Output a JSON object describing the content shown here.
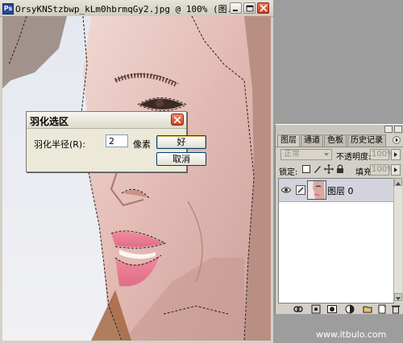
{
  "document_window": {
    "title": "OrsyKNStzbwp_kLm0hbrmqGy2.jpg @ 100% (图...",
    "app_icon_glyph": "Ps",
    "minimize_icon": "minimize-icon",
    "maximize_icon": "maximize-icon",
    "close_icon": "close-icon"
  },
  "feather_dialog": {
    "title": "羽化选区",
    "radius_label": "羽化半径(R):",
    "radius_value": "2",
    "unit_label": "像素",
    "ok_label": "好",
    "cancel_label": "取消"
  },
  "layers_panel": {
    "tabs": [
      {
        "label": "图层",
        "active": true
      },
      {
        "label": "通道",
        "active": false
      },
      {
        "label": "色板",
        "active": false
      },
      {
        "label": "历史记录",
        "active": false
      }
    ],
    "blend_mode": "正常",
    "opacity_label": "不透明度:",
    "opacity_value": "100%",
    "lock_label": "锁定:",
    "fill_label": "填充:",
    "fill_value": "100%",
    "layers": [
      {
        "name": "图层 0",
        "visible": true
      }
    ]
  },
  "watermark": "www.itbulo.com",
  "colors": {
    "background": "#9d9d9d",
    "panel_bg": "#d4d0c8",
    "dialog_bg": "#ece9d8",
    "selected_layer": "#d3d3dd",
    "close_red": "#c4401f"
  }
}
